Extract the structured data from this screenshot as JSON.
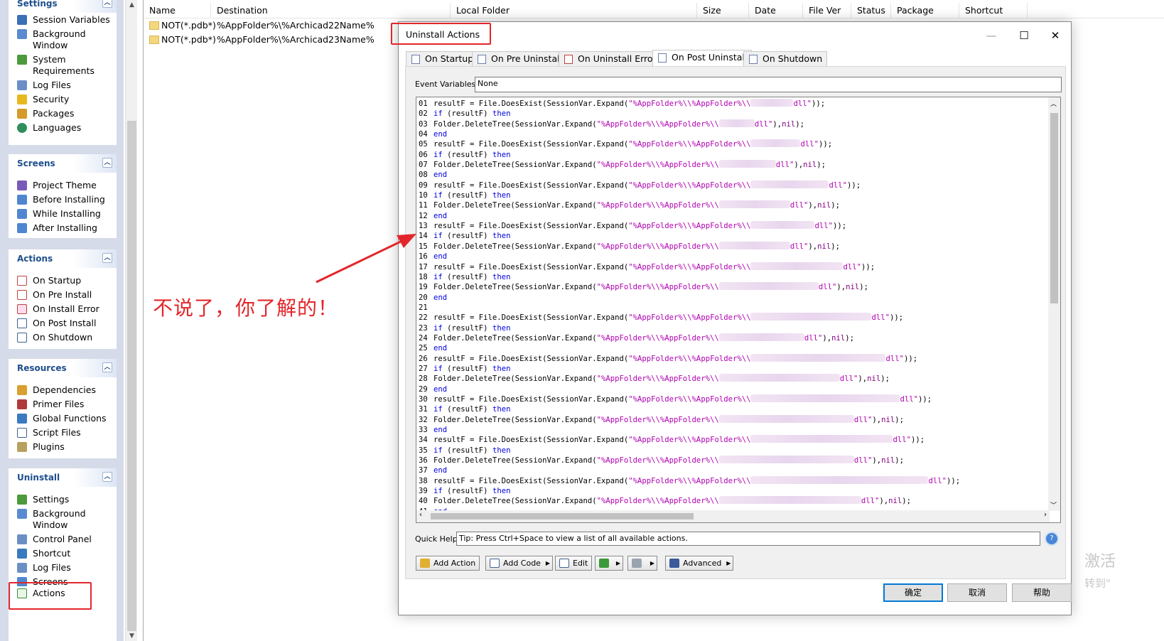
{
  "sidebar": {
    "settings": {
      "title": "Settings",
      "items": [
        {
          "label": "Session Variables",
          "icon": "variables-icon"
        },
        {
          "label": "Background Window",
          "icon": "window-icon"
        },
        {
          "label": "System Requirements",
          "icon": "requirements-icon"
        },
        {
          "label": "Log Files",
          "icon": "log-icon"
        },
        {
          "label": "Security",
          "icon": "lock-icon"
        },
        {
          "label": "Packages",
          "icon": "package-icon"
        },
        {
          "label": "Languages",
          "icon": "globe-icon"
        }
      ]
    },
    "screens": {
      "title": "Screens",
      "items": [
        {
          "label": "Project Theme"
        },
        {
          "label": "Before Installing"
        },
        {
          "label": "While Installing"
        },
        {
          "label": "After Installing"
        }
      ]
    },
    "actions": {
      "title": "Actions",
      "items": [
        {
          "label": "On Startup"
        },
        {
          "label": "On Pre Install"
        },
        {
          "label": "On Install Error"
        },
        {
          "label": "On Post Install"
        },
        {
          "label": "On Shutdown"
        }
      ]
    },
    "resources": {
      "title": "Resources",
      "items": [
        {
          "label": "Dependencies"
        },
        {
          "label": "Primer Files"
        },
        {
          "label": "Global Functions"
        },
        {
          "label": "Script Files"
        },
        {
          "label": "Plugins"
        }
      ]
    },
    "uninstall": {
      "title": "Uninstall",
      "items": [
        {
          "label": "Settings"
        },
        {
          "label": "Background Window"
        },
        {
          "label": "Control Panel"
        },
        {
          "label": "Shortcut"
        },
        {
          "label": "Log Files"
        },
        {
          "label": "Screens"
        },
        {
          "label": "Actions"
        }
      ]
    }
  },
  "filelist": {
    "columns": [
      "Name",
      "Destination",
      "Local Folder",
      "Size",
      "Date",
      "File Ver",
      "Status",
      "Package",
      "Shortcut"
    ],
    "rows": [
      {
        "name": "NOT(*.pdb*)",
        "destination": "%AppFolder%\\%Archicad22Name%"
      },
      {
        "name": "NOT(*.pdb*)",
        "destination": "%AppFolder%\\%Archicad23Name%"
      }
    ]
  },
  "dialog": {
    "title": "Uninstall Actions",
    "tabs": [
      "On Startup",
      "On Pre Uninstall",
      "On Uninstall Error",
      "On Post Uninstall",
      "On Shutdown"
    ],
    "active_tab": "On Post Uninstall",
    "event_variables_label": "Event Variables:",
    "event_variables_value": "None",
    "quick_help_label": "Quick Help:",
    "quick_help_value": "Tip: Press Ctrl+Space to view a list of all available actions.",
    "toolbar": {
      "add_action": "Add Action",
      "add_code": "Add Code",
      "edit": "Edit",
      "advanced": "Advanced"
    },
    "buttons": {
      "ok": "确定",
      "cancel": "取消",
      "help": "帮助"
    }
  },
  "annotation": {
    "text": "不说了，你了解的！"
  },
  "watermark": {
    "line1": "激活",
    "line2": "转到\""
  },
  "colors": {
    "annotation_red": "#e3262b",
    "keyword_blue": "#0000e0",
    "string_purple": "#b000b0"
  }
}
